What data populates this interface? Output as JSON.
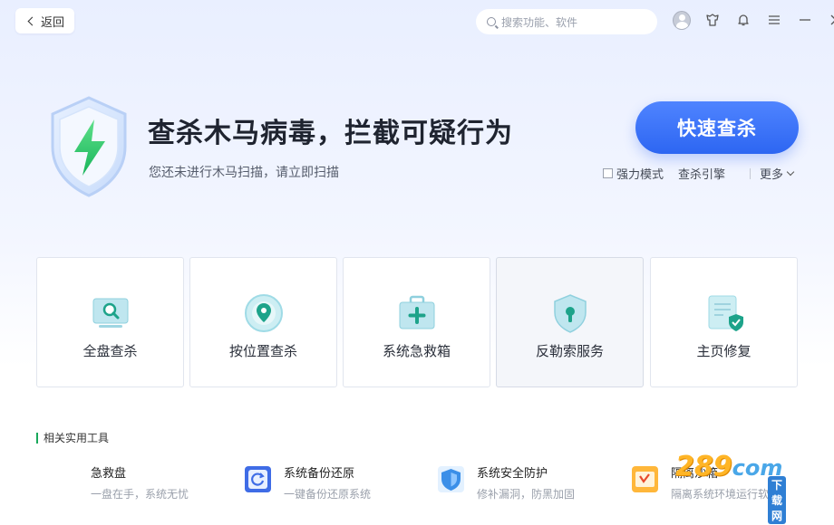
{
  "topbar": {
    "back_label": "返回",
    "search_placeholder": "搜索功能、软件"
  },
  "hero": {
    "title": "查杀木马病毒，拦截可疑行为",
    "subtitle": "您还未进行木马扫描，请立即扫描",
    "scan_button": "快速查杀",
    "option_strong_mode": "强力模式",
    "option_strong_mode_checked": false,
    "option_engine": "查杀引擎",
    "option_more": "更多"
  },
  "cards": [
    {
      "label": "全盘查杀",
      "icon": "monitor-search-icon"
    },
    {
      "label": "按位置查杀",
      "icon": "location-pin-icon"
    },
    {
      "label": "系统急救箱",
      "icon": "first-aid-kit-icon"
    },
    {
      "label": "反勒索服务",
      "icon": "shield-lock-icon"
    },
    {
      "label": "主页修复",
      "icon": "page-check-icon"
    }
  ],
  "tools": {
    "section_title": "相关实用工具",
    "items": [
      {
        "name": "急救盘",
        "desc": "一盘在手，系统无忧"
      },
      {
        "name": "系统备份还原",
        "desc": "一键备份还原系统"
      },
      {
        "name": "系统安全防护",
        "desc": "修补漏洞，防黑加固"
      },
      {
        "name": "隔离沙箱",
        "desc": "隔离系统环境运行软件"
      }
    ]
  },
  "watermark": {
    "num": "289",
    "com": "com",
    "cn": "下载网"
  },
  "colors": {
    "accent": "#2d66f2",
    "green": "#19a85b",
    "bg_top": "#e9efff"
  }
}
